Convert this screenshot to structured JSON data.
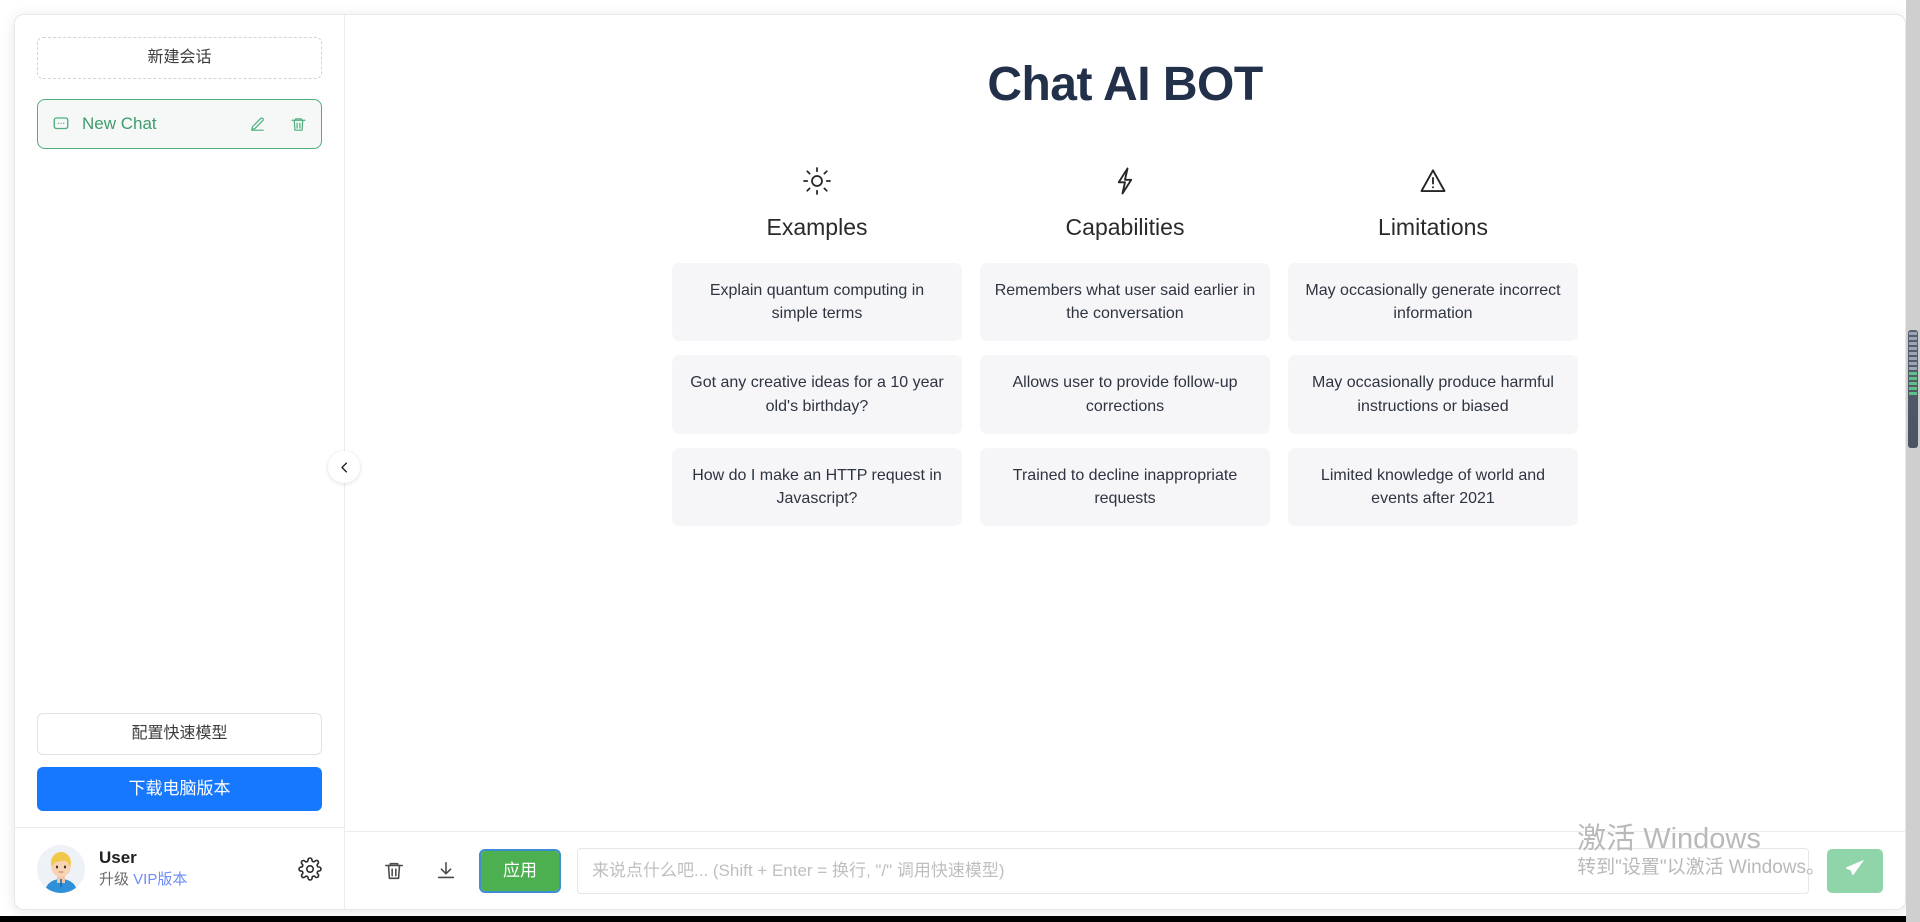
{
  "sidebar": {
    "new_session_label": "新建会话",
    "chats": [
      {
        "title": "New Chat",
        "chat_icon": "chat-bubble-icon",
        "edit_icon": "pencil-icon",
        "delete_icon": "trash-icon"
      }
    ],
    "config_model_label": "配置快速模型",
    "download_desktop_label": "下载电脑版本",
    "user": {
      "name": "User",
      "upgrade_prefix": "升级 ",
      "upgrade_vip": "VIP版本",
      "avatar_icon": "user-avatar",
      "settings_icon": "gear-icon"
    },
    "collapse_icon": "chevron-left-icon"
  },
  "main": {
    "title": "Chat AI BOT",
    "columns": [
      {
        "icon": "sun-icon",
        "title": "Examples",
        "cards": [
          "Explain quantum computing in simple terms",
          "Got any creative ideas for a 10 year old's birthday?",
          "How do I make an HTTP request in Javascript?"
        ]
      },
      {
        "icon": "lightning-bolt-icon",
        "title": "Capabilities",
        "cards": [
          "Remembers what user said earlier in the conversation",
          "Allows user to provide follow-up corrections",
          "Trained to decline inappropriate requests"
        ]
      },
      {
        "icon": "warning-triangle-icon",
        "title": "Limitations",
        "cards": [
          "May occasionally generate incorrect information",
          "May occasionally produce harmful instructions or biased",
          "Limited knowledge of world and events after 2021"
        ]
      }
    ]
  },
  "composer": {
    "clear_icon": "trash-icon",
    "export_icon": "download-icon",
    "apply_label": "应用",
    "input_value": "",
    "input_placeholder": "来说点什么吧... (Shift + Enter = 换行, \"/\" 调用快速模型)",
    "send_icon": "paper-plane-icon"
  },
  "watermark": {
    "title": "激活 Windows",
    "subtitle": "转到\"设置\"以激活 Windows。"
  },
  "colors": {
    "accent_blue": "#1677ff",
    "accent_green": "#4caf50",
    "chat_active_border": "#4caf7d",
    "title_navy": "#22304a",
    "card_bg": "#f6f6f8",
    "send_green": "#8fd5a9",
    "vip_purple": "#6c8cf5"
  }
}
